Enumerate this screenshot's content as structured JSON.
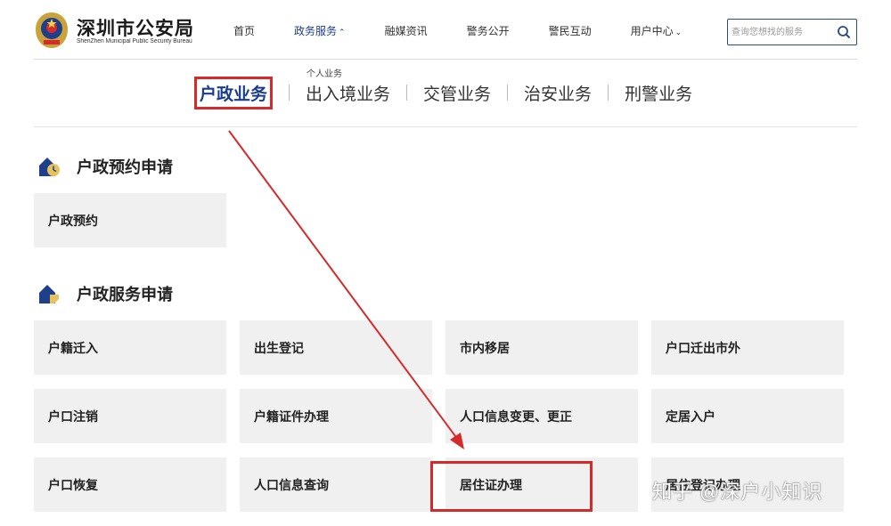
{
  "brand": {
    "title": "深圳市公安局",
    "subtitle": "ShenZhen Municipal Public Security Bureau"
  },
  "nav": {
    "items": [
      {
        "label": "首页"
      },
      {
        "label": "政务服务"
      },
      {
        "label": "融媒资讯"
      },
      {
        "label": "警务公开"
      },
      {
        "label": "警民互动"
      },
      {
        "label": "用户中心"
      }
    ],
    "submenu_hint": "个人业务"
  },
  "search": {
    "placeholder": "查询您想找的服务"
  },
  "tabs": [
    {
      "label": "户政业务"
    },
    {
      "label": "出入境业务"
    },
    {
      "label": "交管业务"
    },
    {
      "label": "治安业务"
    },
    {
      "label": "刑警业务"
    }
  ],
  "sections": [
    {
      "title": "户政预约申请",
      "cards": [
        {
          "label": "户政预约"
        }
      ]
    },
    {
      "title": "户政服务申请",
      "cards": [
        {
          "label": "户籍迁入"
        },
        {
          "label": "出生登记"
        },
        {
          "label": "市内移居"
        },
        {
          "label": "户口迁出市外"
        },
        {
          "label": "户口注销"
        },
        {
          "label": "户籍证件办理"
        },
        {
          "label": "人口信息变更、更正"
        },
        {
          "label": "定居入户"
        },
        {
          "label": "户口恢复"
        },
        {
          "label": "人口信息查询"
        },
        {
          "label": "居住证办理"
        },
        {
          "label": "居住登记办理"
        }
      ]
    }
  ],
  "watermark": "知乎 @深户小知识",
  "colors": {
    "accent": "#1a3c8f",
    "annotation_red": "#d42a2a",
    "card_bg": "#f0f0f0"
  }
}
